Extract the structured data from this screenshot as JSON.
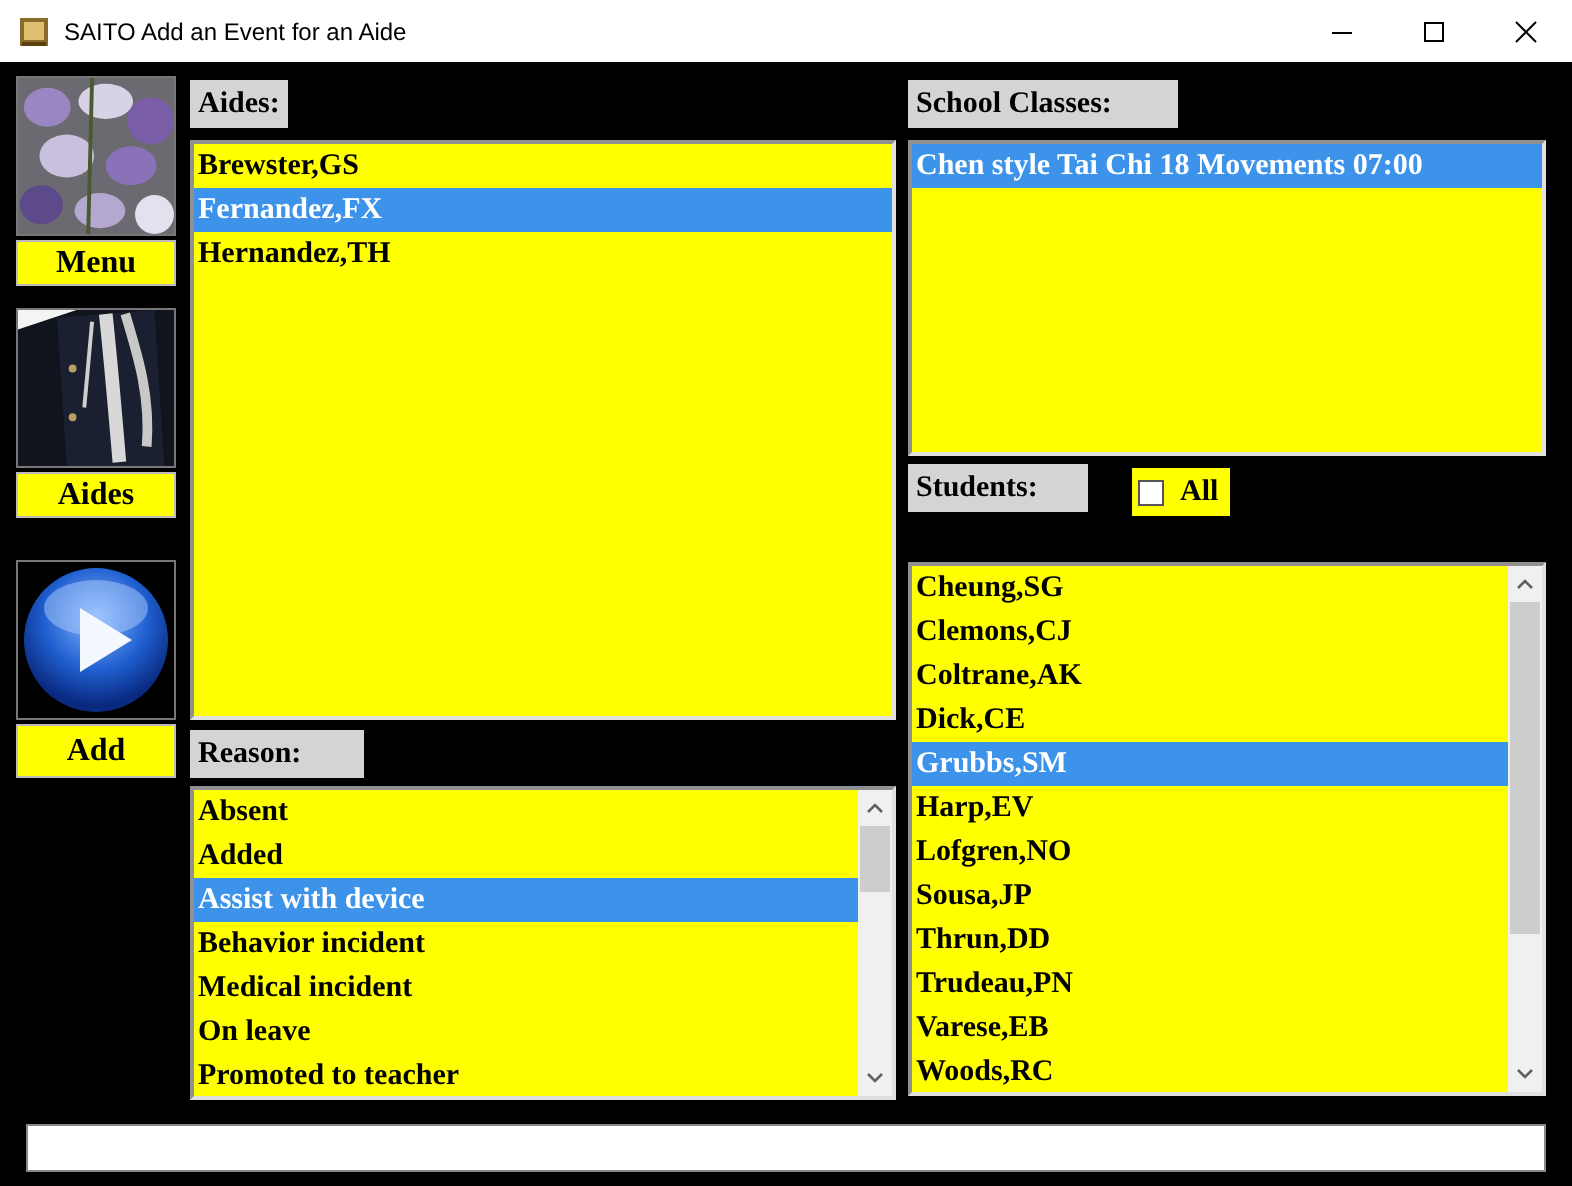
{
  "window": {
    "title": "SAITO Add an Event for an Aide"
  },
  "nav": [
    {
      "label": "Menu",
      "kind": "picture"
    },
    {
      "label": "Aides",
      "kind": "picture"
    },
    {
      "label": "Add",
      "kind": "play"
    }
  ],
  "aides": {
    "label": "Aides:",
    "items": [
      {
        "name": "Brewster,GS",
        "selected": false
      },
      {
        "name": "Fernandez,FX",
        "selected": true
      },
      {
        "name": "Hernandez,TH",
        "selected": false
      }
    ]
  },
  "reason": {
    "label": "Reason:",
    "items": [
      {
        "name": "Absent",
        "selected": false
      },
      {
        "name": "Added",
        "selected": false
      },
      {
        "name": "Assist with device",
        "selected": true
      },
      {
        "name": "Behavior incident",
        "selected": false
      },
      {
        "name": "Medical incident",
        "selected": false
      },
      {
        "name": "On leave",
        "selected": false
      },
      {
        "name": "Promoted to teacher",
        "selected": false
      }
    ]
  },
  "school_classes": {
    "label": "School Classes:",
    "items": [
      {
        "name": "Chen style Tai Chi 18 Movements 07:00",
        "selected": true
      }
    ]
  },
  "students": {
    "label": "Students:",
    "all": {
      "label": "All",
      "checked": false
    },
    "items": [
      {
        "name": "Cheung,SG",
        "selected": false
      },
      {
        "name": "Clemons,CJ",
        "selected": false
      },
      {
        "name": "Coltrane,AK",
        "selected": false
      },
      {
        "name": "Dick,CE",
        "selected": false
      },
      {
        "name": "Grubbs,SM",
        "selected": true
      },
      {
        "name": "Harp,EV",
        "selected": false
      },
      {
        "name": "Lofgren,NO",
        "selected": false
      },
      {
        "name": "Sousa,JP",
        "selected": false
      },
      {
        "name": "Thrun,DD",
        "selected": false
      },
      {
        "name": "Trudeau,PN",
        "selected": false
      },
      {
        "name": "Varese,EB",
        "selected": false
      },
      {
        "name": "Woods,RC",
        "selected": false
      }
    ]
  }
}
